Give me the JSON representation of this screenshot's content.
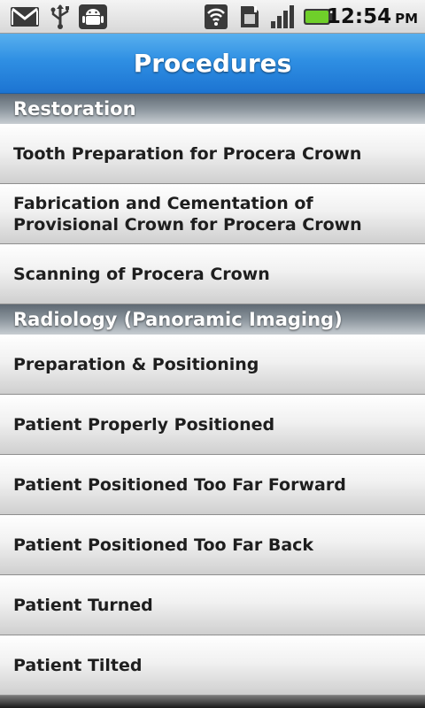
{
  "status_bar": {
    "icons": [
      "gmail-icon",
      "usb-icon",
      "android-debug-icon",
      "wifi-icon",
      "sim-icon",
      "signal-icon",
      "battery-icon"
    ],
    "time": "12:54",
    "ampm": "PM",
    "battery_color": "#6fcf2a"
  },
  "header": {
    "title": "Procedures",
    "accent_color": "#2f8fe3"
  },
  "sections": [
    {
      "title": "Restoration",
      "items": [
        "Tooth Preparation for Procera Crown",
        "Fabrication and Cementation of Provisional Crown for Procera Crown",
        "Scanning of Procera Crown"
      ]
    },
    {
      "title": "Radiology (Panoramic Imaging)",
      "items": [
        "Preparation & Positioning",
        "Patient Properly Positioned",
        "Patient Positioned Too Far Forward",
        "Patient Positioned Too Far Back",
        "Patient Turned",
        "Patient Tilted"
      ]
    }
  ]
}
